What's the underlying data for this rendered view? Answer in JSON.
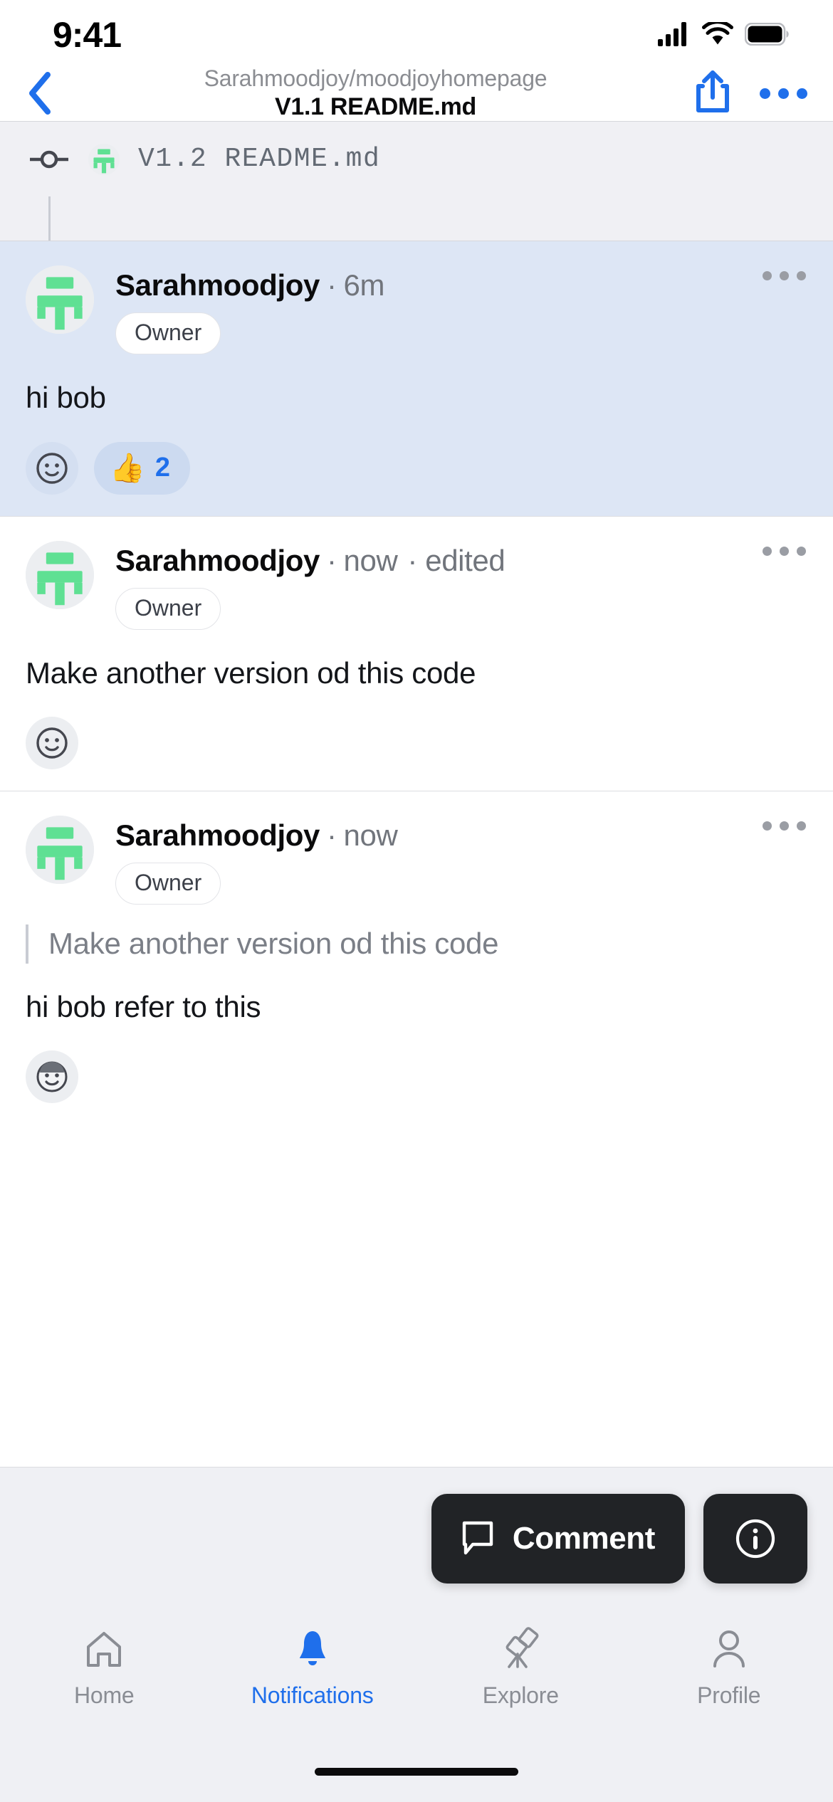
{
  "status_bar": {
    "time": "9:41",
    "icons": [
      "cellular-signal-icon",
      "wifi-icon",
      "battery-icon"
    ]
  },
  "nav_bar": {
    "back_icon": "chevron-left-icon",
    "subtitle": "Sarahmoodjoy/moodjoyhomepage",
    "title": "V1.1 README.md",
    "share_icon": "share-icon",
    "more_icon": "ellipsis-icon"
  },
  "version_bar": {
    "commit_icon": "commit-dot-icon",
    "avatar_icon": "moodjoy-logo-avatar",
    "label": "V1.2 README.md"
  },
  "comments": [
    {
      "author": "Sarahmoodjoy",
      "separator": "·",
      "time": "6m",
      "edited": "",
      "badge": "Owner",
      "quote": "",
      "body": "hi bob",
      "more_icon": "ellipsis-icon",
      "add_reaction_icon": "smiley-face-icon",
      "reaction_emoji": "👍",
      "reaction_count": "2",
      "avatar_type": "logo",
      "highlight": true
    },
    {
      "author": "Sarahmoodjoy",
      "separator": "·",
      "time": "now",
      "edited": "· edited",
      "badge": "Owner",
      "quote": "",
      "body": "Make another version od this code",
      "more_icon": "ellipsis-icon",
      "add_reaction_icon": "smiley-face-icon",
      "reaction_emoji": "",
      "reaction_count": "",
      "avatar_type": "logo",
      "highlight": false
    },
    {
      "author": "Sarahmoodjoy",
      "separator": "·",
      "time": "now",
      "edited": "",
      "badge": "Owner",
      "quote": "Make another version od this code",
      "body": "hi bob refer to this",
      "more_icon": "ellipsis-icon",
      "add_reaction_icon": "person-face-icon",
      "reaction_emoji": "",
      "reaction_count": "",
      "avatar_type": "logo",
      "highlight": false
    }
  ],
  "action_bar": {
    "comment_label": "Comment",
    "comment_icon": "speech-bubble-icon",
    "info_icon": "info-circle-icon"
  },
  "tab_bar": {
    "items": [
      {
        "label": "Home",
        "icon": "home-icon",
        "active": false
      },
      {
        "label": "Notifications",
        "icon": "bell-icon",
        "active": true
      },
      {
        "label": "Explore",
        "icon": "telescope-icon",
        "active": false
      },
      {
        "label": "Profile",
        "icon": "person-icon",
        "active": false
      }
    ]
  },
  "colors": {
    "accent_blue": "#1f6feb",
    "highlight_bg": "#dde6f5",
    "logo_green": "#5fe093",
    "dark_button": "#212326",
    "chrome_gray": "#eff0f4"
  }
}
